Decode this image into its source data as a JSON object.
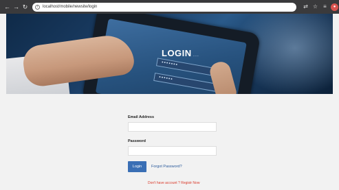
{
  "browser": {
    "back_icon": "←",
    "forward_icon": "→",
    "reload_icon": "↻",
    "info_icon": "i",
    "url": "localhost/mobile/newsite/login",
    "extension_icons": [
      "translate-icon",
      "star-icon",
      "filter-icon",
      "shield-icon"
    ]
  },
  "hero": {
    "title": "LOGIN",
    "title_suffix": "...",
    "tablet_field_1": "•••••••",
    "tablet_field_2": "••••••"
  },
  "form": {
    "email_label": "Email Address",
    "email_value": "",
    "password_label": "Password",
    "password_value": "",
    "login_button": "Login",
    "forgot_link": "Forgot Password?",
    "register_text": "Don't have account ? Registr Now"
  },
  "colors": {
    "primary_button": "#3a6fb5",
    "link": "#2a5a9b",
    "register_text": "#d93a2b",
    "page_background": "#f2f2f2"
  }
}
